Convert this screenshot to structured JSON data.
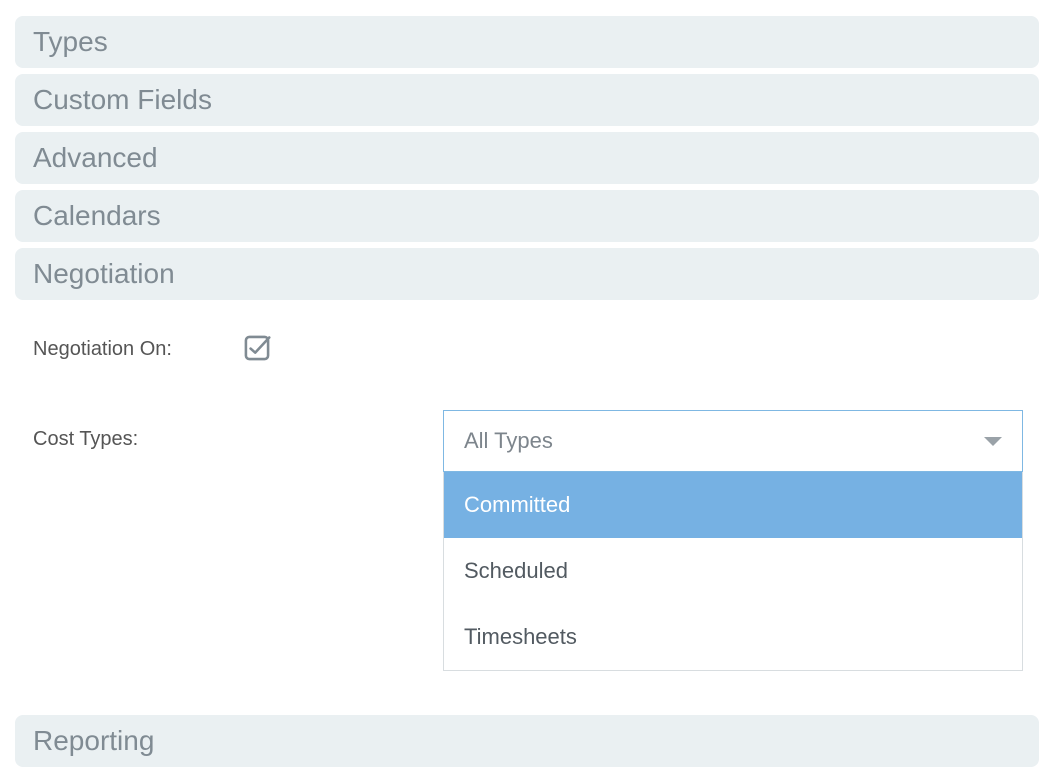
{
  "sections": {
    "types": "Types",
    "custom_fields": "Custom Fields",
    "advanced": "Advanced",
    "calendars": "Calendars",
    "negotiation": "Negotiation",
    "reporting": "Reporting"
  },
  "negotiation_panel": {
    "negotiation_on_label": "Negotiation On:",
    "negotiation_on_checked": true,
    "cost_types_label": "Cost Types:",
    "cost_types_selected": "All Types",
    "cost_types_options": {
      "committed": "Committed",
      "scheduled": "Scheduled",
      "timesheets": "Timesheets"
    },
    "cost_types_highlighted": "committed"
  }
}
